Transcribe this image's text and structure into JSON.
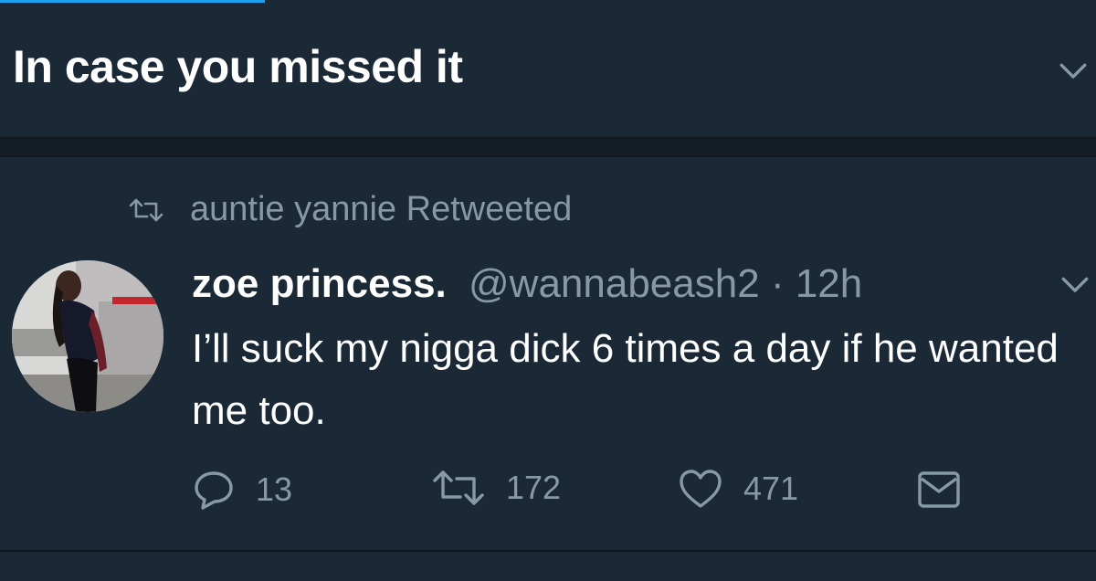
{
  "header": {
    "title": "In case you missed it",
    "chevron_icon": "chevron-down-icon"
  },
  "tweet": {
    "retweeted_by": "auntie yannie Retweeted",
    "author": {
      "display_name": "zoe princess.",
      "handle": "@wannabeash2",
      "time": "· 12h"
    },
    "text": "I’ll suck my nigga dick 6 times a day if he wanted me too.",
    "actions": {
      "reply_count": "13",
      "retweet_count": "172",
      "like_count": "471"
    }
  },
  "colors": {
    "background": "#1b2836",
    "divider": "#141d26",
    "muted_text": "#8899a6",
    "accent": "#1da1f2"
  },
  "icons": [
    "retweet-icon",
    "reply-icon",
    "like-icon",
    "message-icon",
    "chevron-down-icon"
  ]
}
